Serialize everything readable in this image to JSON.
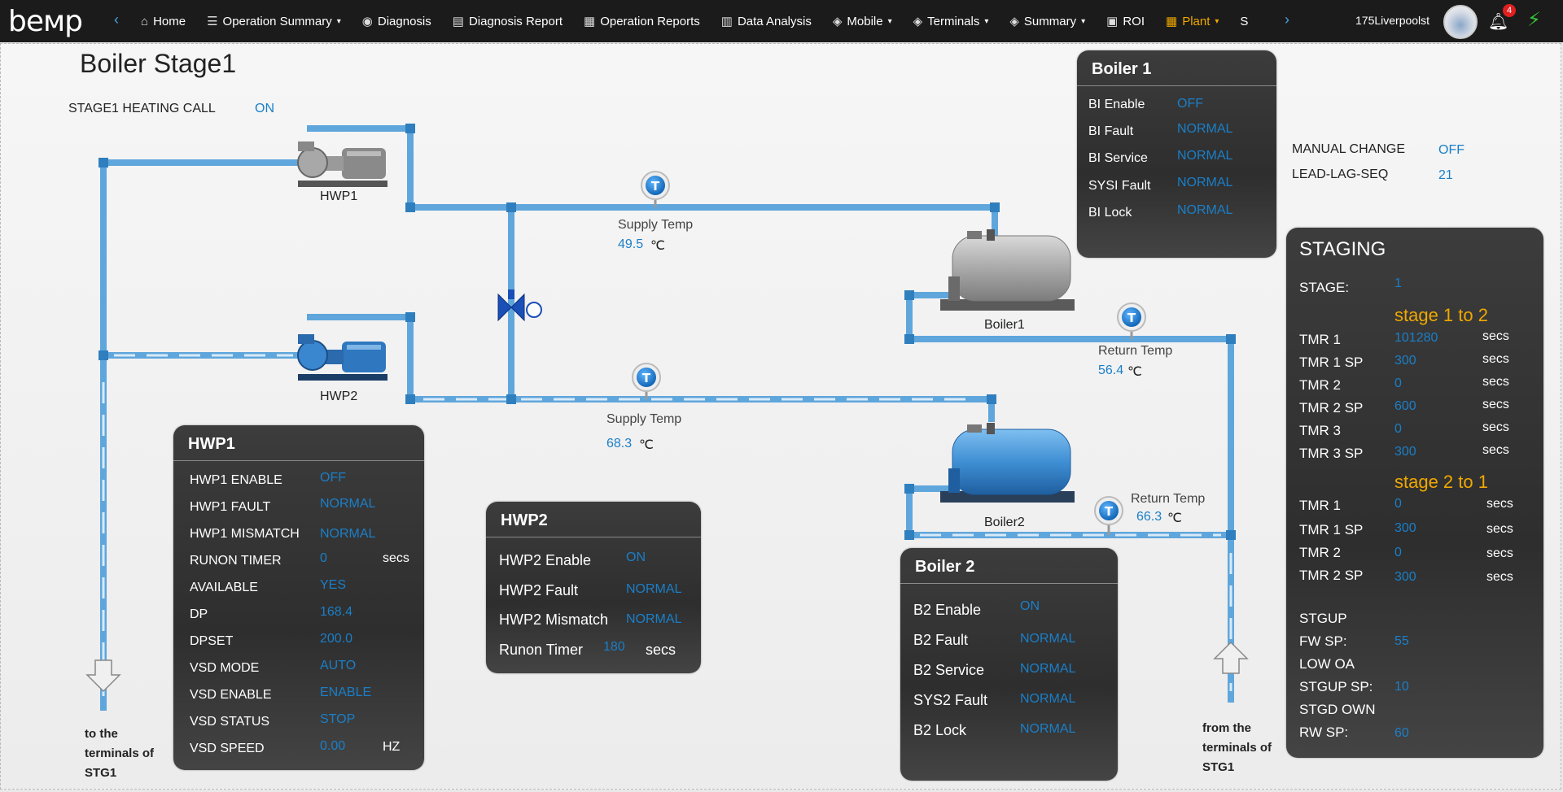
{
  "nav": {
    "logo": "bемp",
    "items": [
      {
        "label": "Home",
        "icon": "home-icon",
        "glyph": "⌂",
        "caret": false
      },
      {
        "label": "Operation Summary",
        "icon": "list-icon",
        "glyph": "☰",
        "caret": true
      },
      {
        "label": "Diagnosis",
        "icon": "diagnosis-icon",
        "glyph": "◉",
        "caret": false
      },
      {
        "label": "Diagnosis Report",
        "icon": "report-icon",
        "glyph": "▤",
        "caret": false
      },
      {
        "label": "Operation Reports",
        "icon": "reports-icon",
        "glyph": "▦",
        "caret": false
      },
      {
        "label": "Data Analysis",
        "icon": "bar-chart-icon",
        "glyph": "▥",
        "caret": false
      },
      {
        "label": "Mobile",
        "icon": "layers-icon",
        "glyph": "◈",
        "caret": true
      },
      {
        "label": "Terminals",
        "icon": "layers-icon",
        "glyph": "◈",
        "caret": true
      },
      {
        "label": "Summary",
        "icon": "layers-icon",
        "glyph": "◈",
        "caret": true
      },
      {
        "label": "ROI",
        "icon": "roi-icon",
        "glyph": "▣",
        "caret": false
      },
      {
        "label": "Plant",
        "icon": "grid-icon",
        "glyph": "▦",
        "caret": true,
        "active": true
      },
      {
        "label": "S",
        "icon": "dollar-icon",
        "glyph": "",
        "caret": false
      }
    ],
    "site": "175Liverpoolst",
    "notifications": "4"
  },
  "page": {
    "title": "Boiler Stage1"
  },
  "heating_call": {
    "label": "STAGE1 HEATING CALL",
    "value": "ON"
  },
  "manual": {
    "manual_change_label": "MANUAL CHANGE",
    "manual_change_value": "OFF",
    "lead_lag_label": "LEAD-LAG-SEQ",
    "lead_lag_value": "21"
  },
  "equipment": {
    "hwp1": "HWP1",
    "hwp2": "HWP2",
    "boiler1": "Boiler1",
    "boiler2": "Boiler2",
    "sensor_glyph": "T"
  },
  "temps": {
    "supply1": {
      "label": "Supply Temp",
      "value": "49.5",
      "unit": "℃"
    },
    "supply2": {
      "label": "Supply Temp",
      "value": "68.3",
      "unit": "℃"
    },
    "return1": {
      "label": "Return Temp",
      "value": "56.4",
      "unit": "℃"
    },
    "return2": {
      "label": "Return Temp",
      "value": "66.3",
      "unit": "℃"
    }
  },
  "terminals": {
    "to": [
      "to the",
      "terminals of",
      "STG1"
    ],
    "from": [
      "from the",
      "terminals of",
      "STG1"
    ]
  },
  "boiler1_panel": {
    "title": "Boiler 1",
    "rows": [
      {
        "label": "BI Enable",
        "value": "OFF"
      },
      {
        "label": "BI Fault",
        "value": "NORMAL"
      },
      {
        "label": "BI Service",
        "value": "NORMAL"
      },
      {
        "label": "SYSI Fault",
        "value": "NORMAL"
      },
      {
        "label": "BI Lock",
        "value": "NORMAL"
      }
    ]
  },
  "boiler2_panel": {
    "title": "Boiler 2",
    "rows": [
      {
        "label": "B2 Enable",
        "value": "ON"
      },
      {
        "label": "B2 Fault",
        "value": "NORMAL"
      },
      {
        "label": "B2 Service",
        "value": "NORMAL"
      },
      {
        "label": "SYS2 Fault",
        "value": "NORMAL"
      },
      {
        "label": "B2 Lock",
        "value": "NORMAL"
      }
    ]
  },
  "hwp1_panel": {
    "title": "HWP1",
    "rows": [
      {
        "label": "HWP1 ENABLE",
        "value": "OFF",
        "unit": ""
      },
      {
        "label": "HWP1 FAULT",
        "value": "NORMAL",
        "unit": ""
      },
      {
        "label": "HWP1 MISMATCH",
        "value": "NORMAL",
        "unit": ""
      },
      {
        "label": "RUNON TIMER",
        "value": "0",
        "unit": "secs"
      },
      {
        "label": "AVAILABLE",
        "value": "YES",
        "unit": ""
      },
      {
        "label": "DP",
        "value": "168.4",
        "unit": ""
      },
      {
        "label": "DPSET",
        "value": "200.0",
        "unit": ""
      },
      {
        "label": "VSD MODE",
        "value": "AUTO",
        "unit": ""
      },
      {
        "label": "VSD ENABLE",
        "value": "ENABLE",
        "unit": ""
      },
      {
        "label": "VSD STATUS",
        "value": "STOP",
        "unit": ""
      },
      {
        "label": "VSD SPEED",
        "value": "0.00",
        "unit": "HZ"
      }
    ]
  },
  "hwp2_panel": {
    "title": "HWP2",
    "rows": [
      {
        "label": "HWP2 Enable",
        "value": "ON",
        "unit": ""
      },
      {
        "label": "HWP2 Fault",
        "value": "NORMAL",
        "unit": ""
      },
      {
        "label": "HWP2 Mismatch",
        "value": "NORMAL",
        "unit": ""
      },
      {
        "label": "Runon Timer",
        "value": "180",
        "unit": "secs"
      }
    ]
  },
  "staging": {
    "title": "STAGING",
    "stage_label": "STAGE:",
    "stage_value": "1",
    "up_title": "stage 1 to 2",
    "up_rows": [
      {
        "label": "TMR 1",
        "value": "101280",
        "unit": "secs"
      },
      {
        "label": "TMR 1 SP",
        "value": "300",
        "unit": "secs"
      },
      {
        "label": "TMR 2",
        "value": "0",
        "unit": "secs"
      },
      {
        "label": "TMR 2 SP",
        "value": "600",
        "unit": "secs"
      },
      {
        "label": "TMR 3",
        "value": "0",
        "unit": "secs"
      },
      {
        "label": "TMR 3 SP",
        "value": "300",
        "unit": "secs"
      }
    ],
    "down_title": "stage 2 to 1",
    "down_rows": [
      {
        "label": "TMR 1",
        "value": "0",
        "unit": "secs"
      },
      {
        "label": "TMR 1 SP",
        "value": "300",
        "unit": "secs"
      },
      {
        "label": "TMR 2",
        "value": "0",
        "unit": "secs"
      },
      {
        "label": "TMR 2 SP",
        "value": "300",
        "unit": "secs"
      }
    ],
    "extra_rows": [
      {
        "label": "STGUP",
        "value": ""
      },
      {
        "label": "FW SP:",
        "value": "55"
      },
      {
        "label": "LOW OA",
        "value": ""
      },
      {
        "label": "STGUP SP:",
        "value": "10"
      },
      {
        "label": "STGD OWN",
        "value": ""
      },
      {
        "label": "RW SP:",
        "value": "60"
      }
    ]
  },
  "colors": {
    "pipe": "#5fa6dc",
    "pipe_dark": "#2f7fbf",
    "value": "#1a7fc8",
    "accent": "#f0a800"
  }
}
